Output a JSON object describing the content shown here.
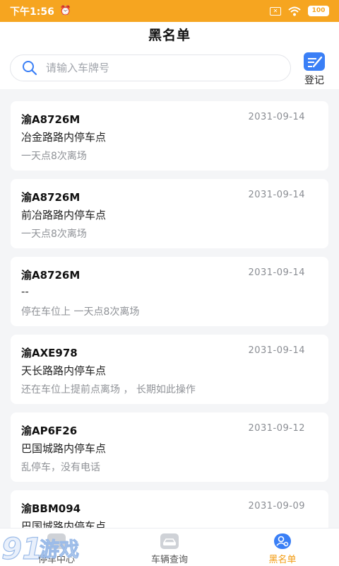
{
  "status_bar": {
    "time": "下午1:56",
    "battery": "100",
    "colors": {
      "background": "#f6a520"
    }
  },
  "header": {
    "title": "黑名单"
  },
  "search": {
    "placeholder": "请输入车牌号",
    "icon": "search-icon"
  },
  "register": {
    "label": "登记",
    "icon": "register-icon"
  },
  "records": [
    {
      "plate": "渝A8726M",
      "date": "2031-09-14",
      "location": "冶金路路内停车点",
      "note": "一天点8次离场"
    },
    {
      "plate": "渝A8726M",
      "date": "2031-09-14",
      "location": "前冶路路内停车点",
      "note": "一天点8次离场"
    },
    {
      "plate": "渝A8726M",
      "date": "2031-09-14",
      "location": "--",
      "note": "停在车位上 一天点8次离场"
    },
    {
      "plate": "渝AXE978",
      "date": "2031-09-14",
      "location": "天长路路内停车点",
      "note": "还在车位上提前点离场 ， 长期如此操作"
    },
    {
      "plate": "渝AP6F26",
      "date": "2031-09-12",
      "location": "巴国城路内停车点",
      "note": "乱停车，没有电话"
    },
    {
      "plate": "渝BBM094",
      "date": "2031-09-09",
      "location": "巴国城路内停车点",
      "note": ""
    }
  ],
  "tabs": [
    {
      "label": "停车中心",
      "icon": "parking-center-icon",
      "active": false
    },
    {
      "label": "车辆查询",
      "icon": "car-query-icon",
      "active": false
    },
    {
      "label": "黑名单",
      "icon": "blacklist-icon",
      "active": true
    }
  ],
  "watermark": {
    "text": "91游戏"
  },
  "colors": {
    "accent": "#3a7ff6",
    "active_tab": "#f29b10"
  }
}
